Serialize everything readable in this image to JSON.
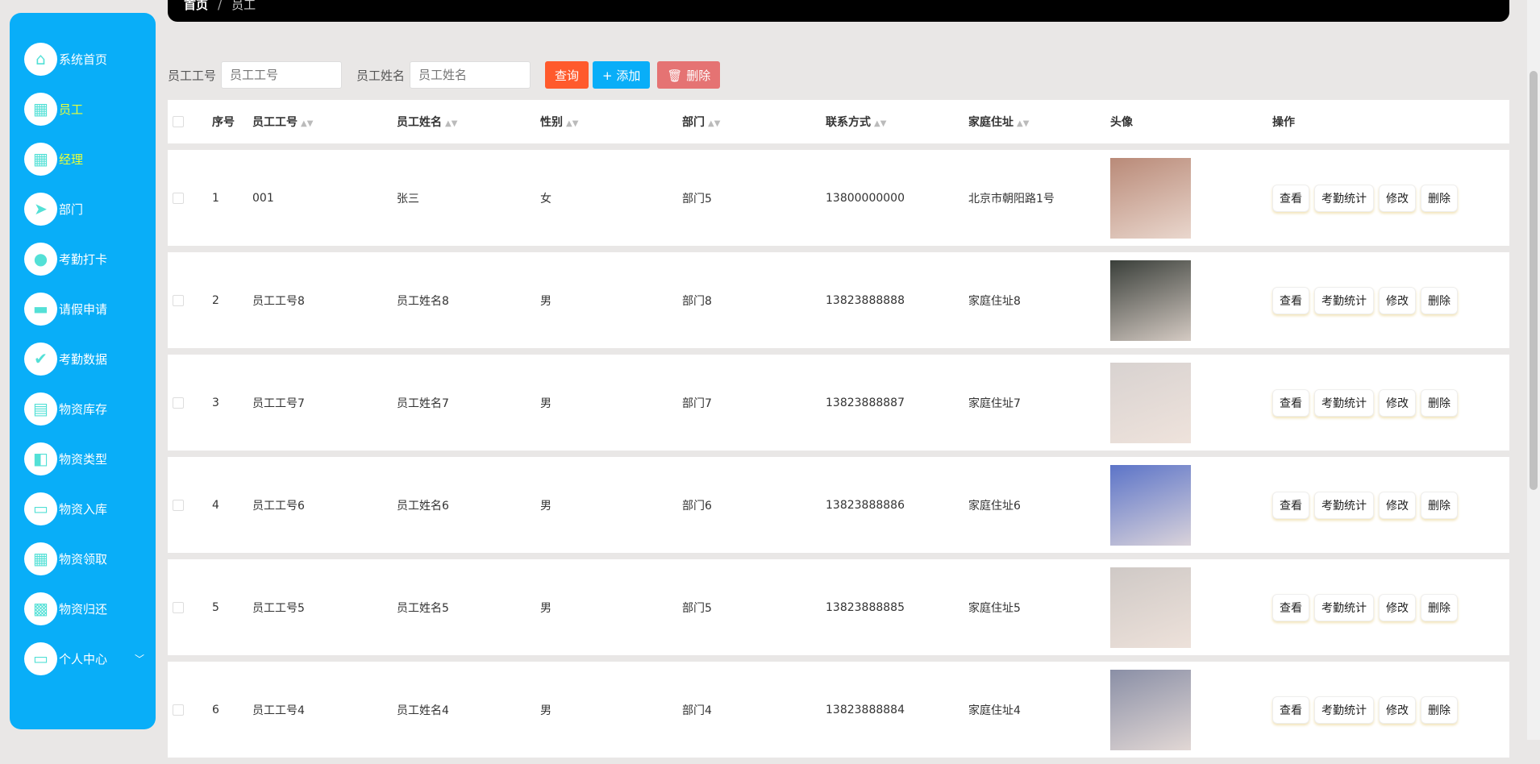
{
  "sidebar": {
    "items": [
      {
        "label": "系统首页",
        "icon": "home-icon",
        "glyph": "⌂"
      },
      {
        "label": "员工",
        "icon": "grid-icon",
        "glyph": "▦",
        "active": true
      },
      {
        "label": "经理",
        "icon": "grid-icon",
        "glyph": "▦",
        "active": true
      },
      {
        "label": "部门",
        "icon": "paper-plane-icon",
        "glyph": "➤"
      },
      {
        "label": "考勤打卡",
        "icon": "bulb-icon",
        "glyph": "●"
      },
      {
        "label": "请假申请",
        "icon": "briefcase-icon",
        "glyph": "▬"
      },
      {
        "label": "考勤数据",
        "icon": "clipboard-check-icon",
        "glyph": "✔"
      },
      {
        "label": "物资库存",
        "icon": "clipboard-icon",
        "glyph": "▤"
      },
      {
        "label": "物资类型",
        "icon": "wallet-icon",
        "glyph": "◧"
      },
      {
        "label": "物资入库",
        "icon": "monitor-icon",
        "glyph": "▭"
      },
      {
        "label": "物资领取",
        "icon": "grid-icon",
        "glyph": "▦"
      },
      {
        "label": "物资归还",
        "icon": "apps-icon",
        "glyph": "▩"
      },
      {
        "label": "个人中心",
        "icon": "card-icon",
        "glyph": "▭",
        "chevron": "﹀"
      }
    ]
  },
  "breadcrumb": {
    "home": "首页",
    "sep": "/",
    "current": "员工"
  },
  "search": {
    "id_label": "员工工号",
    "id_placeholder": "员工工号",
    "name_label": "员工姓名",
    "name_placeholder": "员工姓名",
    "query": "查询",
    "add": "+ 添加",
    "delete": "🗑 删除"
  },
  "colors": {
    "sidebar": "#09aef8",
    "query": "#ff5a2c",
    "add": "#09aef8",
    "delete": "#e57373"
  },
  "table": {
    "headers": [
      "序号",
      "员工工号",
      "员工姓名",
      "性别",
      "部门",
      "联系方式",
      "家庭住址",
      "头像",
      "操作"
    ],
    "actions": [
      "查看",
      "考勤统计",
      "修改",
      "删除"
    ],
    "rows": [
      {
        "no": "1",
        "id": "001",
        "name": "张三",
        "gender": "女",
        "dept": "部门5",
        "phone": "13800000000",
        "addr": "北京市朝阳路1号",
        "c": "#b98a78"
      },
      {
        "no": "2",
        "id": "员工工号8",
        "name": "员工姓名8",
        "gender": "男",
        "dept": "部门8",
        "phone": "13823888888",
        "addr": "家庭住址8",
        "c": "#3a3f3a"
      },
      {
        "no": "3",
        "id": "员工工号7",
        "name": "员工姓名7",
        "gender": "男",
        "dept": "部门7",
        "phone": "13823888887",
        "addr": "家庭住址7",
        "c": "#d8d2d0"
      },
      {
        "no": "4",
        "id": "员工工号6",
        "name": "员工姓名6",
        "gender": "男",
        "dept": "部门6",
        "phone": "13823888886",
        "addr": "家庭住址6",
        "c": "#5c74c8"
      },
      {
        "no": "5",
        "id": "员工工号5",
        "name": "员工姓名5",
        "gender": "男",
        "dept": "部门5",
        "phone": "13823888885",
        "addr": "家庭住址5",
        "c": "#cfc9c6"
      },
      {
        "no": "6",
        "id": "员工工号4",
        "name": "员工姓名4",
        "gender": "男",
        "dept": "部门4",
        "phone": "13823888884",
        "addr": "家庭住址4",
        "c": "#8a8fa6"
      }
    ]
  }
}
